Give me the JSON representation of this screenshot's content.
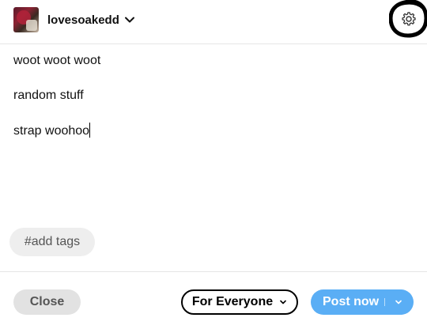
{
  "header": {
    "blog_name": "lovesoakedd",
    "avatar_icon": "blog-avatar-image",
    "dropdown_icon": "chevron-down-icon",
    "settings_icon": "gear-icon"
  },
  "post": {
    "lines": [
      "woot woot woot",
      "random stuff",
      "strap woohoo"
    ]
  },
  "tags": {
    "placeholder": "#add tags"
  },
  "footer": {
    "close_label": "Close",
    "audience_label": "For Everyone",
    "post_label": "Post now",
    "post_color": "#5aaef5"
  }
}
